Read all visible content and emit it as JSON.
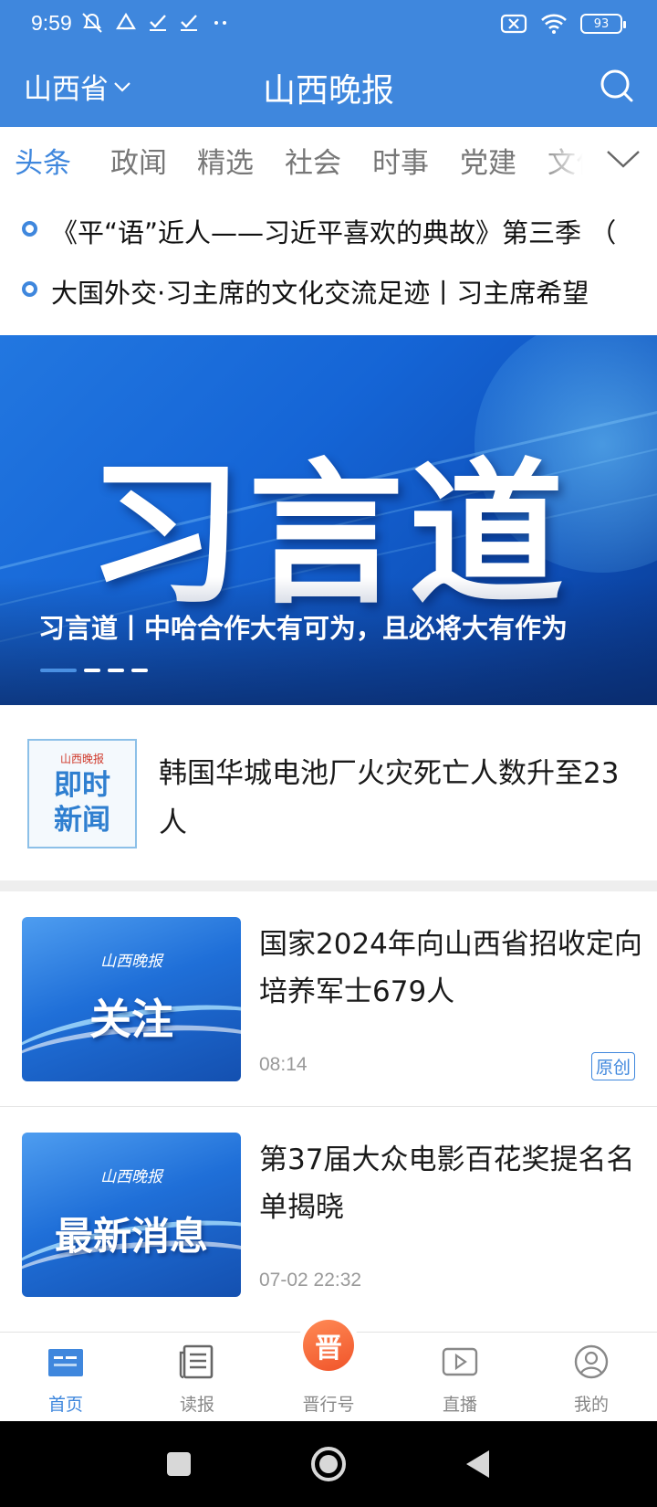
{
  "status_bar": {
    "time": "9:59",
    "left_icons": [
      "mute-icon",
      "drive-icon",
      "check-icon",
      "check-icon",
      "more-dots-icon"
    ],
    "battery": "93"
  },
  "header": {
    "province": "山西省",
    "title": "山西晚报",
    "color": "#3f87dd"
  },
  "tabs": [
    {
      "label": "头条",
      "active": true
    },
    {
      "label": "政闻",
      "active": false
    },
    {
      "label": "精选",
      "active": false
    },
    {
      "label": "社会",
      "active": false
    },
    {
      "label": "时事",
      "active": false
    },
    {
      "label": "党建",
      "active": false
    },
    {
      "label": "文化",
      "active": false
    }
  ],
  "headlines": [
    "《平“语”近人——习近平喜欢的典故》第三季 （",
    "大国外交·习主席的文化交流足迹丨习主席希望"
  ],
  "banner": {
    "big_text": "习言道",
    "caption": "习言道丨中哈合作大有可为，且必将大有作为",
    "slide_count": 4,
    "active_slide": 1
  },
  "flash_news": {
    "brand": "山西晚报",
    "logo_text": "即时新闻",
    "title": "韩国华城电池厂火灾死亡人数升至23人"
  },
  "news": [
    {
      "thumb_brand": "山西晚报",
      "thumb_text": "关注",
      "title": "国家2024年向山西省招收定向培养军士679人",
      "time": "08:14",
      "badge": "原创"
    },
    {
      "thumb_brand": "山西晚报",
      "thumb_text": "最新消息",
      "title": "第37届大众电影百花奖提名名单揭晓",
      "time": "07-02 22:32",
      "badge": ""
    }
  ],
  "bottom_nav": [
    {
      "label": "首页",
      "icon": "home-news-icon",
      "active": true
    },
    {
      "label": "读报",
      "icon": "newspaper-icon",
      "active": false
    },
    {
      "label": "晋行号",
      "icon": "jin-icon",
      "active": false,
      "badge_text": "晋"
    },
    {
      "label": "直播",
      "icon": "live-play-icon",
      "active": false
    },
    {
      "label": "我的",
      "icon": "profile-icon",
      "active": false
    }
  ]
}
